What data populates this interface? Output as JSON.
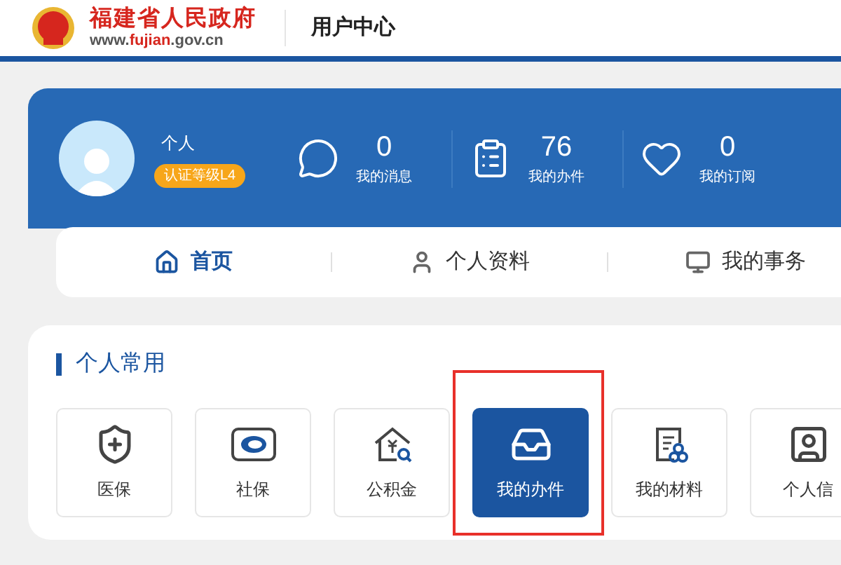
{
  "header": {
    "site_name": "福建省人民政府",
    "site_url_parts": [
      {
        "text": "www.",
        "highlight": false
      },
      {
        "text": "fujian",
        "highlight": true
      },
      {
        "text": ".gov.cn",
        "highlight": false
      }
    ],
    "title": "用户中心"
  },
  "profile": {
    "name": "个人",
    "badge": "认证等级L4"
  },
  "stats": [
    {
      "kind": "message",
      "value": "0",
      "label": "我的消息"
    },
    {
      "kind": "clipboard",
      "value": "76",
      "label": "我的办件"
    },
    {
      "kind": "heart",
      "value": "0",
      "label": "我的订阅"
    }
  ],
  "tabs": [
    {
      "kind": "home",
      "label": "首页",
      "selected": true
    },
    {
      "kind": "user",
      "label": "个人资料",
      "selected": false
    },
    {
      "kind": "affairs",
      "label": "我的事务",
      "selected": false
    }
  ],
  "section": {
    "title": "个人常用",
    "tiles": [
      {
        "kind": "medical",
        "label": "医保",
        "selected": false,
        "highlighted": false
      },
      {
        "kind": "social",
        "label": "社保",
        "selected": false,
        "highlighted": false
      },
      {
        "kind": "fund",
        "label": "公积金",
        "selected": false,
        "highlighted": false
      },
      {
        "kind": "cases",
        "label": "我的办件",
        "selected": true,
        "highlighted": true
      },
      {
        "kind": "materials",
        "label": "我的材料",
        "selected": false,
        "highlighted": false
      },
      {
        "kind": "info",
        "label": "个人信",
        "selected": false,
        "highlighted": false
      }
    ]
  }
}
